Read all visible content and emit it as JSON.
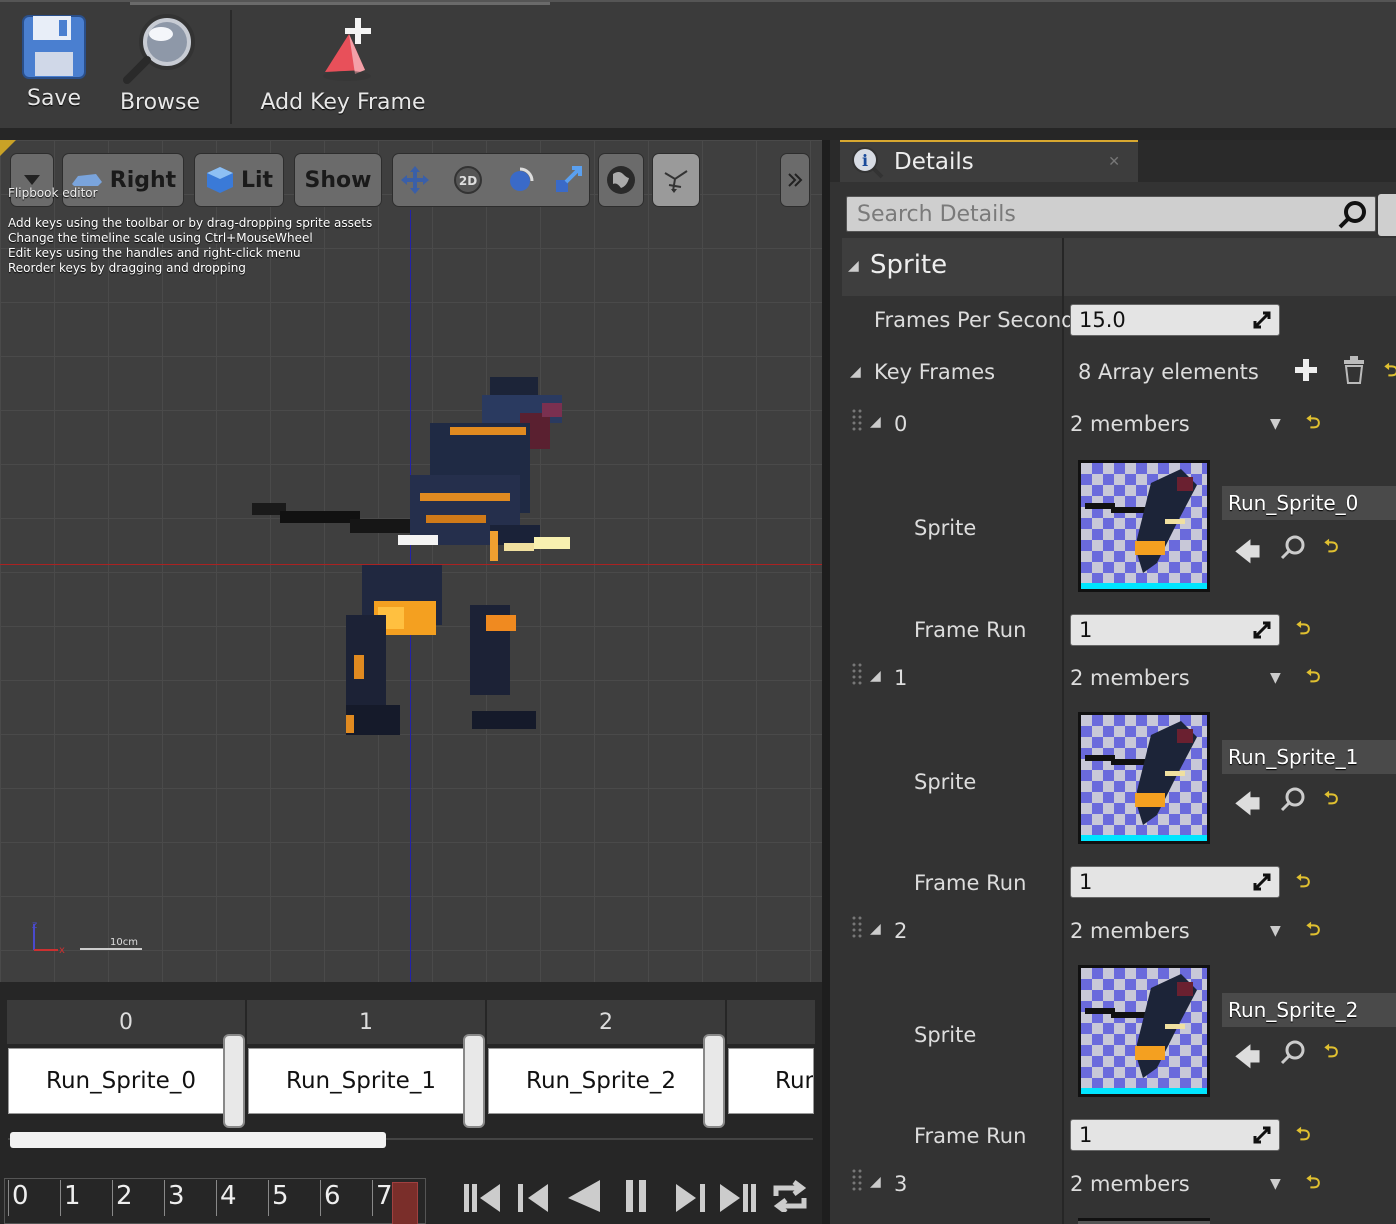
{
  "toolbar": {
    "save_label": "Save",
    "browse_label": "Browse",
    "add_key_frame_label": "Add Key Frame"
  },
  "viewport": {
    "view_mode": "Right",
    "lighting_mode": "Lit",
    "show_label": "Show",
    "transform_2d_label": "2D",
    "editor_label": "Flipbook editor",
    "hints": [
      "Add keys using the toolbar or by drag-dropping sprite assets",
      "Change the timeline scale using Ctrl+MouseWheel",
      "Edit keys using the handles and right-click menu",
      "Reorder keys by dragging and dropping"
    ],
    "scale_label": "10cm",
    "axis_z": "z",
    "axis_x": "x"
  },
  "timeline": {
    "headers": [
      "0",
      "1",
      "2"
    ],
    "frames": [
      "Run_Sprite_0",
      "Run_Sprite_1",
      "Run_Sprite_2",
      "Run"
    ],
    "frame_numbers": [
      "0",
      "1",
      "2",
      "3",
      "4",
      "5",
      "6",
      "7"
    ],
    "current_frame": "7",
    "playback_buttons": [
      "skip-to-start",
      "step-back",
      "play-reverse",
      "pause",
      "step-forward",
      "skip-to-end",
      "loop"
    ],
    "scroll_visible_fraction": 0.47
  },
  "details": {
    "tab_title": "Details",
    "search_placeholder": "Search Details",
    "category": "Sprite",
    "fps_label": "Frames Per Second",
    "fps_value": "15.0",
    "key_frames_label": "Key Frames",
    "key_frames_count": "8 Array elements",
    "items": [
      {
        "index": "0",
        "members": "2 members",
        "sprite_label": "Sprite",
        "sprite_name": "Run_Sprite_0",
        "frame_run_label": "Frame Run",
        "frame_run": "1"
      },
      {
        "index": "1",
        "members": "2 members",
        "sprite_label": "Sprite",
        "sprite_name": "Run_Sprite_1",
        "frame_run_label": "Frame Run",
        "frame_run": "1"
      },
      {
        "index": "2",
        "members": "2 members",
        "sprite_label": "Sprite",
        "sprite_name": "Run_Sprite_2",
        "frame_run_label": "Frame Run",
        "frame_run": "1"
      },
      {
        "index": "3",
        "members": "2 members"
      }
    ]
  },
  "colors": {
    "accent": "#d8a830",
    "reset_arrow": "#e0c030",
    "thumb_bar": "#00e5ff"
  }
}
